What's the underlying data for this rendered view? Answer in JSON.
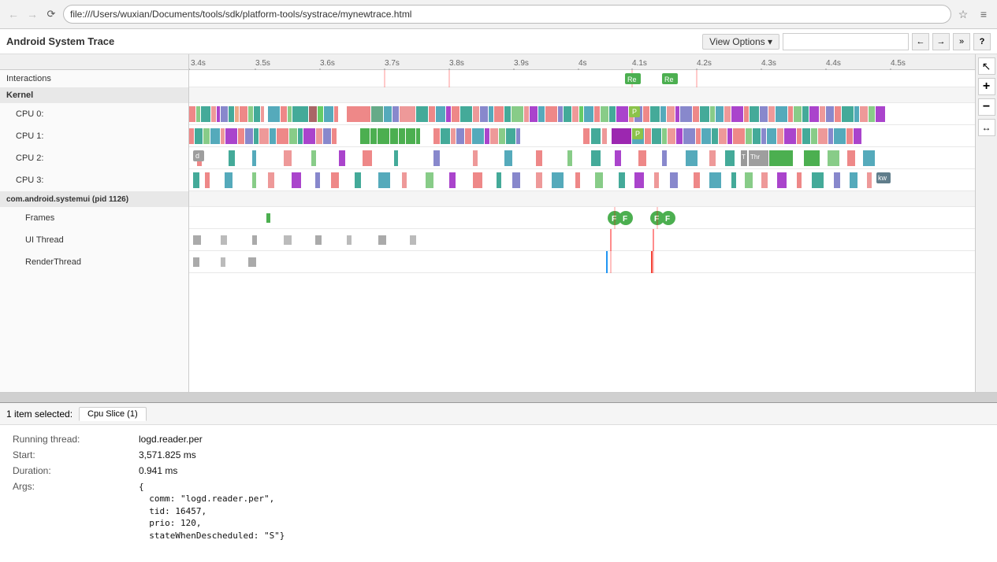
{
  "browser": {
    "url": "file:///Users/wuxian/Documents/tools/sdk/platform-tools/systrace/mynewtrace.html",
    "back_disabled": true,
    "forward_disabled": true
  },
  "app": {
    "title": "Android System Trace",
    "view_options_label": "View Options ▾",
    "search_placeholder": "",
    "help_label": "?"
  },
  "timeline": {
    "ticks": [
      "3.4s",
      "3.5s",
      "3.6s",
      "3.7s",
      "3.8s",
      "3.9s",
      "4s",
      "4.1s",
      "4.2s",
      "4.3s",
      "4.4s",
      "4.5s"
    ]
  },
  "tracks": {
    "interactions": "Interactions",
    "kernel": "Kernel",
    "cpu0": "CPU 0:",
    "cpu1": "CPU 1:",
    "cpu2": "CPU 2:",
    "cpu3": "CPU 3:",
    "systemui": "com.android.systemui (pid 1126)",
    "frames": "Frames",
    "ui_thread": "UI Thread",
    "render_thread": "RenderThread"
  },
  "bottom_panel": {
    "selected_info": "1 item selected:",
    "tab_label": "Cpu Slice (1)",
    "running_thread_label": "Running thread:",
    "running_thread_value": "logd.reader.per",
    "start_label": "Start:",
    "start_value": "3,571.825 ms",
    "duration_label": "Duration:",
    "duration_value": "0.941 ms",
    "args_label": "Args:",
    "args_value": "{\n  comm: \"logd.reader.per\",\n  tid: 16457,\n  prio: 120,\n  stateWhenDescheduled: \"S\"}"
  },
  "right_toolbar": {
    "select_icon": "↖",
    "zoom_in_icon": "+",
    "zoom_out_icon": "−",
    "fit_icon": "↔"
  }
}
